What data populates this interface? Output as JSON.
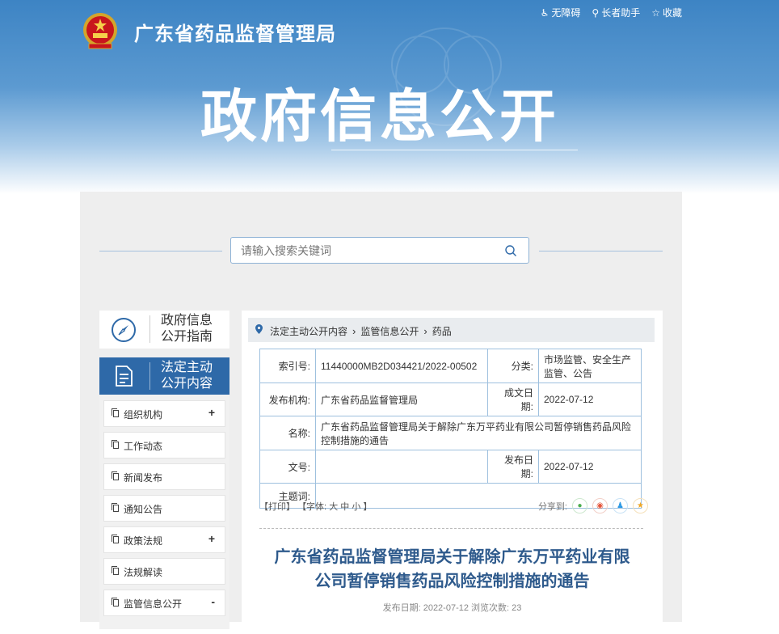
{
  "header": {
    "site_title": "广东省药品监督管理局",
    "top_links": [
      {
        "label": "无障碍",
        "icon": "accessibility-icon"
      },
      {
        "label": "长者助手",
        "icon": "elderly-helper-icon"
      },
      {
        "label": "收藏",
        "icon": "star-icon"
      }
    ],
    "big_title": "政府信息公开"
  },
  "search": {
    "placeholder": "请输入搜索关键词",
    "value": ""
  },
  "sidebar": {
    "guide": {
      "line1": "政府信息",
      "line2": "公开指南",
      "icon": "compass-icon"
    },
    "active": {
      "line1": "法定主动",
      "line2": "公开内容",
      "icon": "document-icon"
    },
    "items": [
      {
        "label": "组织机构",
        "toggle": "+"
      },
      {
        "label": "工作动态",
        "toggle": ""
      },
      {
        "label": "新闻发布",
        "toggle": ""
      },
      {
        "label": "通知公告",
        "toggle": ""
      },
      {
        "label": "政策法规",
        "toggle": "+"
      },
      {
        "label": "法规解读",
        "toggle": ""
      },
      {
        "label": "监管信息公开",
        "toggle": "-"
      }
    ]
  },
  "breadcrumb": [
    "法定主动公开内容",
    "监管信息公开",
    "药品"
  ],
  "meta_table": {
    "index_label": "索引号:",
    "index_value": "11440000MB2D034421/2022-00502",
    "category_label": "分类:",
    "category_value": "市场监管、安全生产监管、公告",
    "publisher_label": "发布机构:",
    "publisher_value": "广东省药品监督管理局",
    "created_label": "成文日期:",
    "created_value": "2022-07-12",
    "name_label": "名称:",
    "name_value": "广东省药品监督管理局关于解除广东万平药业有限公司暂停销售药品风险控制措施的通告",
    "docno_label": "文号:",
    "docno_value": "",
    "pubdate_label": "发布日期:",
    "pubdate_value": "2022-07-12",
    "subject_label": "主题词:",
    "subject_value": ""
  },
  "tools": {
    "print": "【打印】",
    "font_prefix": "【字体:",
    "large": "大",
    "medium": "中",
    "small": "小",
    "font_suffix": "】"
  },
  "share": {
    "label": "分享到:"
  },
  "article": {
    "title_line1": "广东省药品监督管理局关于解除广东万平药业有限",
    "title_line2": "公司暂停销售药品风险控制措施的通告",
    "meta": "发布日期: 2022-07-12   浏览次数: 23"
  },
  "colors": {
    "primary": "#2e69a8",
    "title_blue": "#2e5a8c"
  }
}
